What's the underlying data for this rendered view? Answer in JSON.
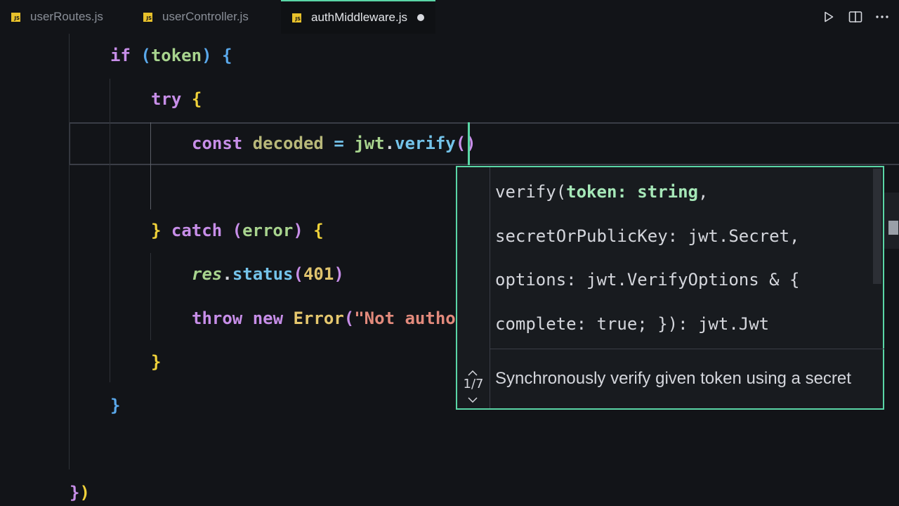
{
  "tabs": [
    {
      "label": "userRoutes.js",
      "icon": "js-file-icon",
      "active": false
    },
    {
      "label": "userController.js",
      "icon": "js-file-icon",
      "active": false
    },
    {
      "label": "authMiddleware.js",
      "icon": "js-file-icon",
      "active": true,
      "dirty": true
    }
  ],
  "tab_icon_text": "JS",
  "actions": [
    "run-icon",
    "split-editor-icon",
    "more-icon"
  ],
  "code": {
    "l1": {
      "kw": "if",
      "open": "(",
      "var": "token",
      "close": ")",
      "brace": "{"
    },
    "l2": {
      "kw": "try",
      "brace": "{"
    },
    "l3": {
      "kw": "const",
      "var": "decoded",
      "eq": "=",
      "obj": "jwt",
      "dot": ".",
      "fn": "verify",
      "parens": "()"
    },
    "l5": {
      "close": "}",
      "kw": "catch",
      "open": "(",
      "var": "error",
      "rp": ")",
      "brace": "{"
    },
    "l6": {
      "obj": "res",
      "dot": ".",
      "fn": "status",
      "open": "(",
      "num": "401",
      "close": ")"
    },
    "l7": {
      "kw1": "throw",
      "kw2": "new",
      "cls": "Error",
      "open": "(",
      "str": "\"Not autho"
    },
    "l8": {
      "brace": "}"
    },
    "l9": {
      "brace": "}"
    },
    "l11": {
      "brace": "}",
      "paren": ")"
    }
  },
  "signature_help": {
    "name": "verify(",
    "active_param": "token: string",
    "after_active": ",",
    "line2": "secretOrPublicKey: jwt.Secret,",
    "line3": "options: jwt.VerifyOptions & {",
    "line4": "complete: true; }): jwt.Jwt",
    "doc": "Synchronously verify given token using a secret",
    "counter": "1/7"
  },
  "colors": {
    "accent": "#5ad6a6",
    "background": "#121418",
    "keyword": "#c78ee8",
    "function": "#74c3ea"
  }
}
